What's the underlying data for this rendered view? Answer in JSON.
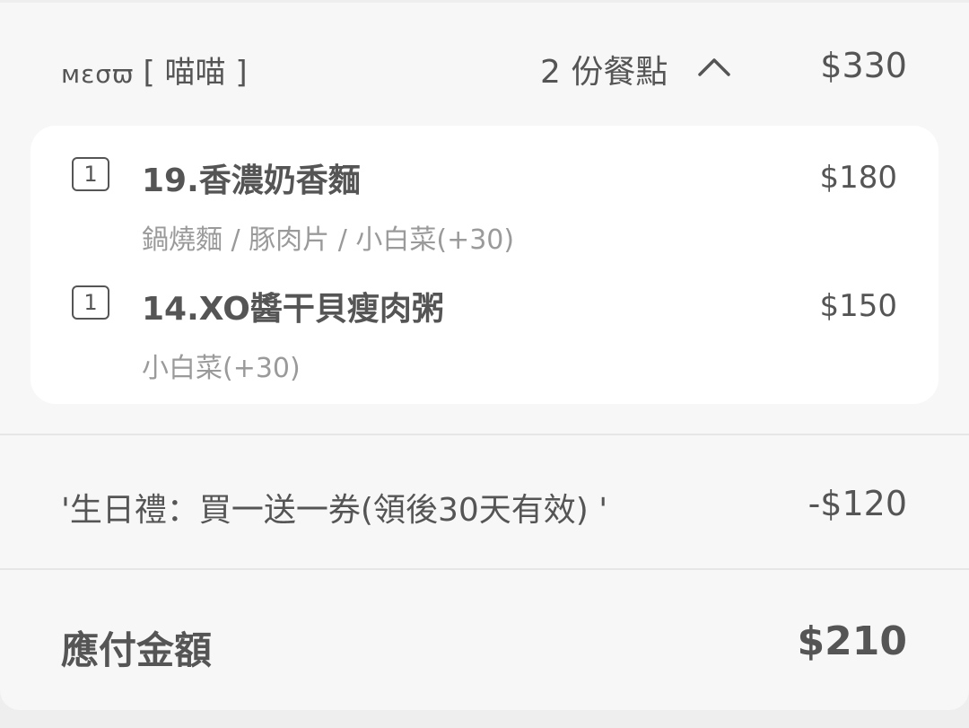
{
  "store": {
    "logo_text": "мεσϖ",
    "name": "[ 喵喵 ]",
    "item_count_label": "2 份餐點",
    "total": "$330"
  },
  "items": [
    {
      "qty": "1",
      "name": "19.香濃奶香麵",
      "price": "$180",
      "options": "鍋燒麵 / 豚肉片 / 小白菜(+30)"
    },
    {
      "qty": "1",
      "name": "14.XO醬干貝瘦肉粥",
      "price": "$150",
      "options": "小白菜(+30)"
    }
  ],
  "discount": {
    "label": "'生日禮：買一送一券(領後30天有效) '",
    "value": "-$120"
  },
  "total": {
    "label": "應付金額",
    "value": "$210"
  },
  "icons": {
    "collapse": "chevron-up-icon"
  }
}
